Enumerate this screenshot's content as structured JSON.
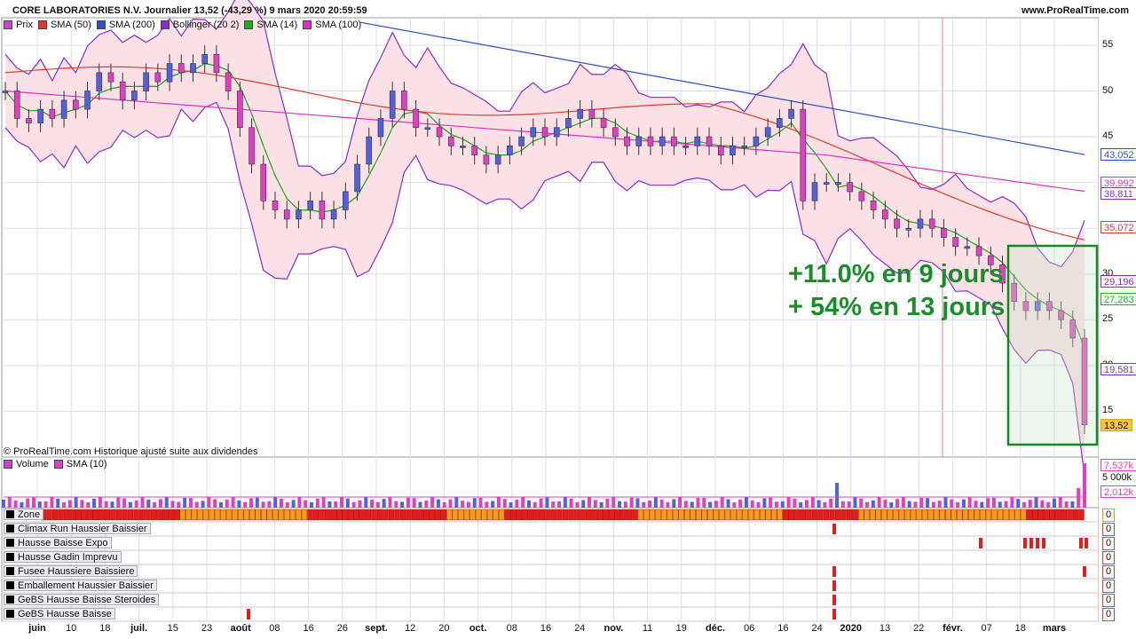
{
  "header": {
    "title": "CORE LABORATORIES N.V. Journalier 13,52 (-43,29 %) 9 mars 2020 20:59:59",
    "site": "www.ProRealTime.com"
  },
  "price_legend": [
    {
      "label": "Prix",
      "color": "#cc44cc"
    },
    {
      "label": "SMA (50)",
      "color": "#e03a2a"
    },
    {
      "label": "SMA (200)",
      "color": "#2c4fc4"
    },
    {
      "label": "Bollinger (20 2)",
      "color": "#8a2cc4"
    },
    {
      "label": "SMA (14)",
      "color": "#22b022"
    },
    {
      "label": "SMA (100)",
      "color": "#e030c0"
    }
  ],
  "volume_legend": [
    {
      "label": "Volume",
      "color": "#cc44cc"
    },
    {
      "label": "SMA (10)",
      "color": "#e040c0"
    }
  ],
  "footnote": "© ProRealTime.com  Historique ajusté suite aux dividendes",
  "annotations": [
    "+11.0% en 9 jours",
    "+ 54% en 13 jours"
  ],
  "price_tags": [
    {
      "value": "43,052",
      "color": "#2c4fc4",
      "y": 43.052
    },
    {
      "value": "39,992",
      "color": "#e030c0",
      "y": 39.992
    },
    {
      "value": "38,811",
      "color": "#8a2cc4",
      "y": 38.811
    },
    {
      "value": "35,072",
      "color": "#e03a2a",
      "y": 35.072
    },
    {
      "value": "29,196",
      "color": "#8a2cc4",
      "y": 29.196
    },
    {
      "value": "27,283",
      "color": "#22b022",
      "y": 27.283
    },
    {
      "value": "19,581",
      "color": "#8a2cc4",
      "y": 19.581
    },
    {
      "value": "13,52",
      "color": "#e8a000",
      "y": 13.52
    }
  ],
  "volume_tags": [
    {
      "value": "7,537k",
      "color": "#e040c0"
    },
    {
      "value": "5 000k",
      "color": ""
    },
    {
      "value": "2,012k",
      "color": "#e040c0"
    }
  ],
  "indicators": [
    {
      "label": "Zone",
      "value": "0"
    },
    {
      "label": "Climax Run Haussier Baissier",
      "value": "0"
    },
    {
      "label": "Hausse Baisse Expo",
      "value": "0"
    },
    {
      "label": "Hausse Gadin Imprevu",
      "value": "0"
    },
    {
      "label": "Fusee Haussiere Baissiere",
      "value": "0"
    },
    {
      "label": "Emballement Haussier Baissier",
      "value": "0"
    },
    {
      "label": "GeBS Hausse Baisse Steroides",
      "value": "0"
    },
    {
      "label": "GeBS Hausse Baisse",
      "value": "0"
    }
  ],
  "chart_data": {
    "type": "candlestick",
    "title": "CORE LABORATORIES N.V. Journalier",
    "y_axis_ticks": [
      15,
      20,
      25,
      30,
      35,
      40,
      45,
      50,
      55
    ],
    "ylim": [
      10,
      58
    ],
    "x_axis_ticks": [
      {
        "label": "juin",
        "bold": true
      },
      {
        "label": "10"
      },
      {
        "label": "18"
      },
      {
        "label": "juil.",
        "bold": true
      },
      {
        "label": "15"
      },
      {
        "label": "23"
      },
      {
        "label": "août",
        "bold": true
      },
      {
        "label": "08"
      },
      {
        "label": "16"
      },
      {
        "label": "26"
      },
      {
        "label": "sept.",
        "bold": true
      },
      {
        "label": "12"
      },
      {
        "label": "20"
      },
      {
        "label": "oct.",
        "bold": true
      },
      {
        "label": "08"
      },
      {
        "label": "16"
      },
      {
        "label": "24"
      },
      {
        "label": "nov.",
        "bold": true
      },
      {
        "label": "11"
      },
      {
        "label": "19"
      },
      {
        "label": "déc.",
        "bold": true
      },
      {
        "label": "06"
      },
      {
        "label": "16"
      },
      {
        "label": "24"
      },
      {
        "label": "2020",
        "bold": true
      },
      {
        "label": "13"
      },
      {
        "label": "22"
      },
      {
        "label": "févr.",
        "bold": true
      },
      {
        "label": "07"
      },
      {
        "label": "18"
      },
      {
        "label": "mars",
        "bold": true
      }
    ],
    "close_path": [
      50,
      47,
      46.5,
      48,
      47,
      49,
      48,
      50,
      52,
      51,
      49,
      50,
      52,
      51,
      53,
      52,
      53,
      54,
      52,
      50,
      46,
      42,
      38,
      37,
      36,
      37,
      38,
      36,
      37,
      39,
      42,
      45,
      47,
      50,
      48,
      46,
      46,
      45,
      44,
      44,
      43,
      42,
      43,
      44,
      45,
      46,
      45,
      46,
      47,
      48,
      47,
      46,
      45,
      44,
      45,
      44,
      45,
      44,
      44,
      45,
      44,
      43,
      44,
      44,
      45,
      46,
      47,
      48,
      38,
      40,
      40,
      40,
      39,
      38,
      37,
      36,
      35,
      35,
      36,
      35,
      34,
      33,
      33,
      32,
      31,
      29,
      27,
      26,
      27,
      26,
      25,
      23,
      13.52
    ],
    "last_close": 13.52,
    "change_pct": -43.29,
    "date": "9 mars 2020",
    "volume_scale_k": [
      7537,
      5000,
      2012
    ]
  }
}
